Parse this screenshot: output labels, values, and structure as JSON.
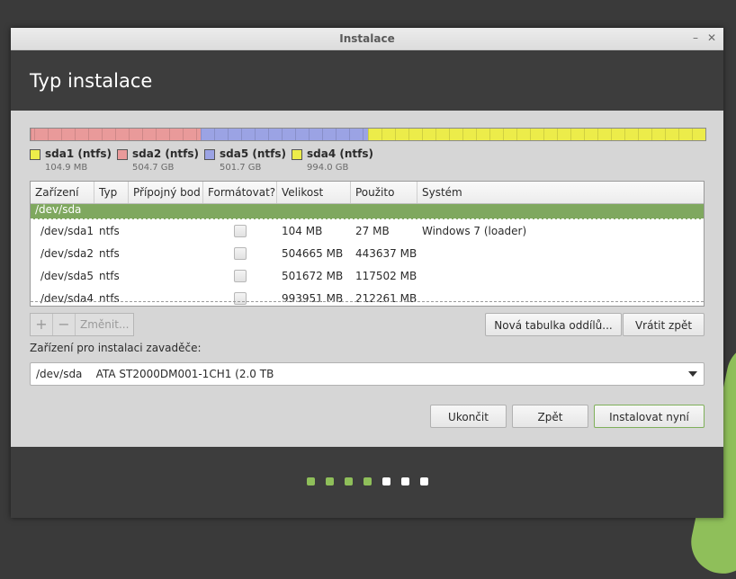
{
  "window": {
    "title": "Instalace",
    "minimize_glyph": "–",
    "close_glyph": "✕"
  },
  "header": {
    "title": "Typ instalace"
  },
  "partition_bar": {
    "segments": [
      {
        "name": "sda1",
        "fraction": 0.005,
        "color": "#e99a9a"
      },
      {
        "name": "sda2",
        "fraction": 0.247,
        "color": "#e99a9a"
      },
      {
        "name": "sda5",
        "fraction": 0.248,
        "color": "#9ba3e4"
      },
      {
        "name": "sda4",
        "fraction": 0.5,
        "color": "#ecec4a"
      }
    ]
  },
  "legend": [
    {
      "label": "sda1 (ntfs)",
      "size": "104.9 MB",
      "color": "#ecec4a"
    },
    {
      "label": "sda2 (ntfs)",
      "size": "504.7 GB",
      "color": "#e99a9a"
    },
    {
      "label": "sda5 (ntfs)",
      "size": "501.7 GB",
      "color": "#9ba3e4"
    },
    {
      "label": "sda4 (ntfs)",
      "size": "994.0 GB",
      "color": "#ecec4a"
    }
  ],
  "table": {
    "columns": [
      "Zařízení",
      "Typ",
      "Přípojný bod",
      "Formátovat?",
      "Velikost",
      "Použito",
      "Systém"
    ],
    "selected_row": "/dev/sda",
    "rows": [
      {
        "device": "/dev/sda1",
        "type": "ntfs",
        "mount": "",
        "format": false,
        "size": "104 MB",
        "used": "27 MB",
        "system": "Windows 7 (loader)"
      },
      {
        "device": "/dev/sda2",
        "type": "ntfs",
        "mount": "",
        "format": false,
        "size": "504665 MB",
        "used": "443637 MB",
        "system": ""
      },
      {
        "device": "/dev/sda5",
        "type": "ntfs",
        "mount": "",
        "format": false,
        "size": "501672 MB",
        "used": "117502 MB",
        "system": ""
      },
      {
        "device": "/dev/sda4",
        "type": "ntfs",
        "mount": "",
        "format": false,
        "size": "993951 MB",
        "used": "212261 MB",
        "system": ""
      }
    ]
  },
  "toolbar": {
    "add": "+",
    "remove": "−",
    "change": "Změnit..."
  },
  "buttons": {
    "new_table": "Nová tabulka oddílů...",
    "revert": "Vrátit zpět",
    "quit": "Ukončit",
    "back": "Zpět",
    "install": "Instalovat nyní"
  },
  "bootloader": {
    "label": "Zařízení pro instalaci zavaděče:",
    "value": "/dev/sda    ATA ST2000DM001-1CH1 (2.0 TB"
  },
  "progress": {
    "total_steps": 7,
    "completed_steps": 4,
    "active_color": "#8fbf5a",
    "inactive_color": "#ffffff"
  }
}
